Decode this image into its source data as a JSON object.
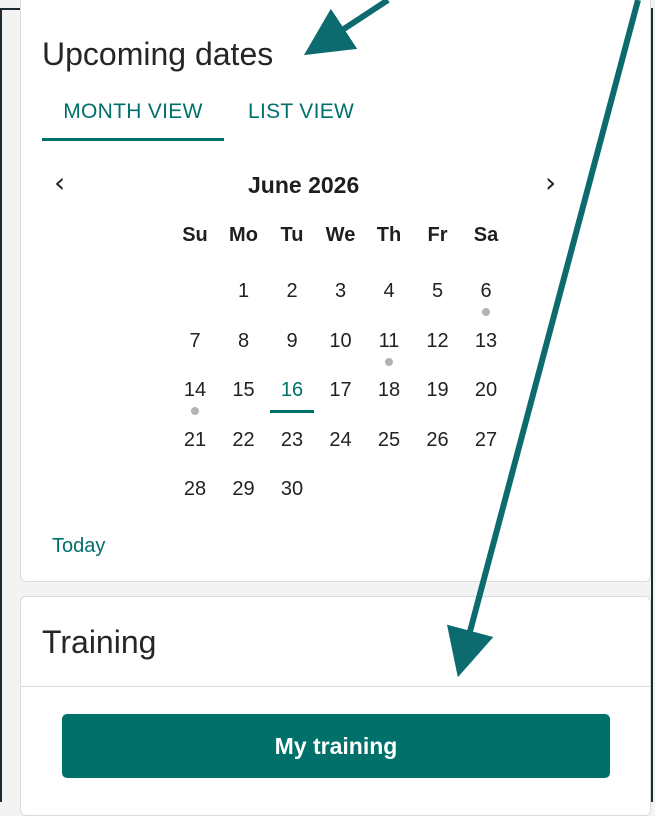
{
  "upcoming": {
    "title": "Upcoming dates",
    "tabs": [
      {
        "label": "MONTH VIEW",
        "active": true
      },
      {
        "label": "LIST VIEW",
        "active": false
      }
    ],
    "prev_icon": "chevron-left-icon",
    "next_icon": "chevron-right-icon",
    "month_label": "June 2026",
    "weekdays": [
      "Su",
      "Mo",
      "Tu",
      "We",
      "Th",
      "Fr",
      "Sa"
    ],
    "weeks": [
      [
        "",
        "1",
        "2",
        "3",
        "4",
        "5",
        "6"
      ],
      [
        "7",
        "8",
        "9",
        "10",
        "11",
        "12",
        "13"
      ],
      [
        "14",
        "15",
        "16",
        "17",
        "18",
        "19",
        "20"
      ],
      [
        "21",
        "22",
        "23",
        "24",
        "25",
        "26",
        "27"
      ],
      [
        "28",
        "29",
        "30",
        "",
        "",
        "",
        ""
      ]
    ],
    "today_day": "16",
    "event_days": [
      "6",
      "11",
      "14"
    ],
    "today_link": "Today"
  },
  "training": {
    "title": "Training",
    "button_label": "My training"
  },
  "colors": {
    "accent": "#00706b",
    "arrow": "#0b6b6e",
    "event_dot": "#b3b3b3"
  }
}
